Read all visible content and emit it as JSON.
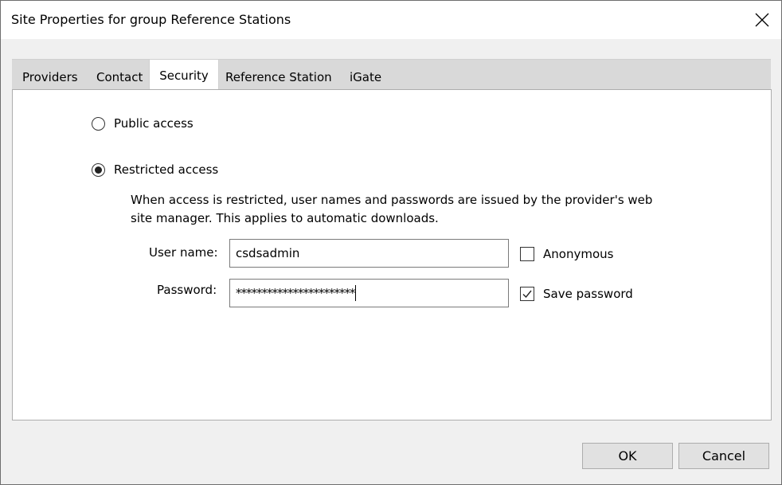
{
  "window": {
    "title": "Site Properties for group Reference Stations"
  },
  "tabs": [
    {
      "label": "Providers"
    },
    {
      "label": "Contact"
    },
    {
      "label": "Security"
    },
    {
      "label": "Reference Station"
    },
    {
      "label": "iGate"
    }
  ],
  "active_tab": "Security",
  "security": {
    "public_label": "Public access",
    "restricted_label": "Restricted access",
    "selected_access": "Restricted access",
    "description_line1": "When access is restricted, user names and passwords are issued by the provider's web",
    "description_line2": "site manager. This applies to automatic downloads.",
    "username_label": "User name:",
    "username_value": "csdsadmin",
    "password_label": "Password:",
    "password_value": "***********************",
    "anonymous_label": "Anonymous",
    "anonymous_checked": false,
    "save_password_label": "Save password",
    "save_password_checked": true
  },
  "buttons": {
    "ok": "OK",
    "cancel": "Cancel"
  },
  "icons": {
    "close": "close-icon",
    "radio": "radio-icon",
    "checkmark": "checkmark-icon"
  }
}
